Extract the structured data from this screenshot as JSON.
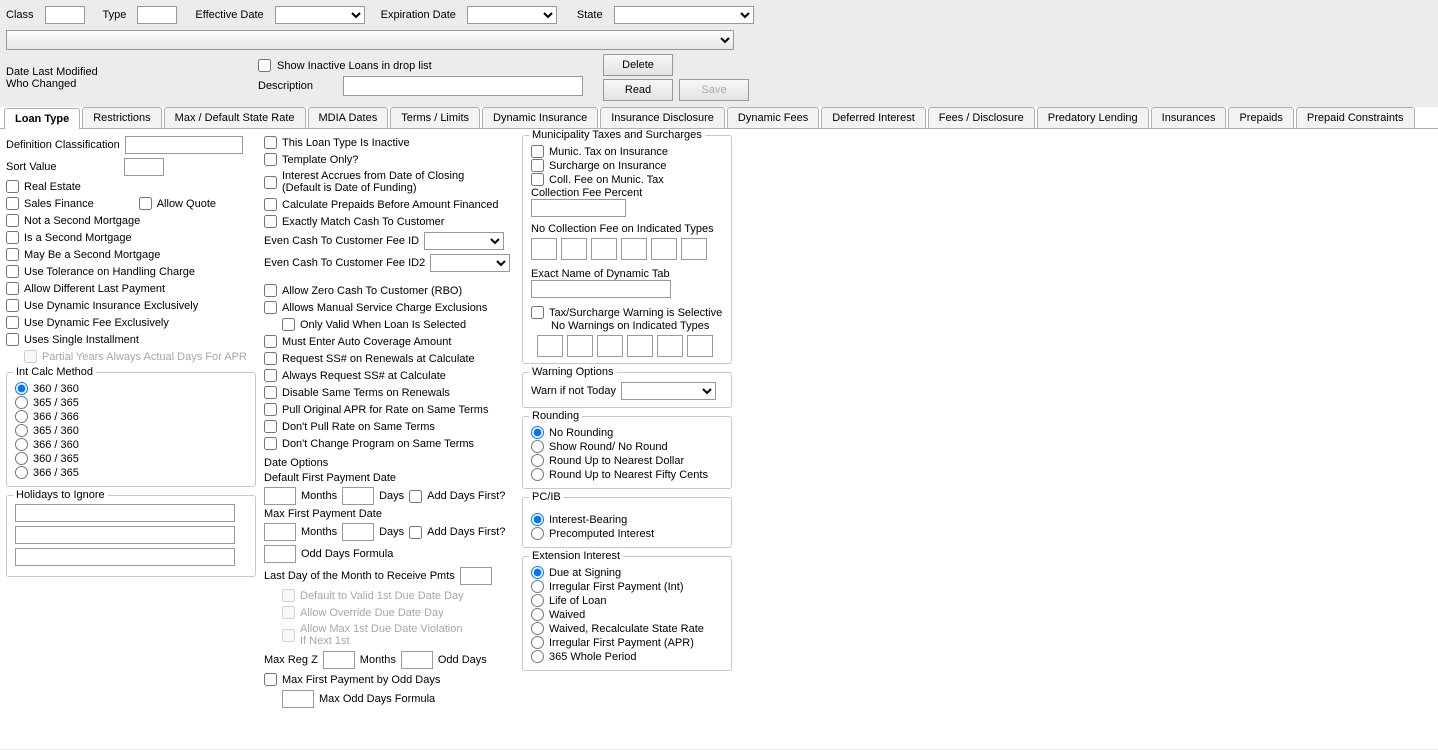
{
  "top": {
    "class_label": "Class",
    "type_label": "Type",
    "eff_date_label": "Effective Date",
    "exp_date_label": "Expiration Date",
    "state_label": "State"
  },
  "meta": {
    "date_last_modified": "Date Last Modified",
    "who_changed": "Who Changed",
    "show_inactive": "Show Inactive Loans in drop list",
    "description_label": "Description",
    "delete": "Delete",
    "read": "Read",
    "save": "Save"
  },
  "tabs": [
    "Loan Type",
    "Restrictions",
    "Max / Default State Rate",
    "MDIA Dates",
    "Terms / Limits",
    "Dynamic Insurance",
    "Insurance Disclosure",
    "Dynamic Fees",
    "Deferred Interest",
    "Fees / Disclosure",
    "Predatory Lending",
    "Insurances",
    "Prepaids",
    "Prepaid Constraints"
  ],
  "colA": {
    "def_class": "Definition Classification",
    "sort_value": "Sort Value",
    "real_estate": "Real Estate",
    "sales_finance": "Sales Finance",
    "allow_quote": "Allow Quote",
    "not_second": "Not a Second Mortgage",
    "is_second": "Is a Second Mortgage",
    "may_be_second": "May Be a Second Mortgage",
    "use_tolerance": "Use Tolerance on Handling Charge",
    "allow_diff_last": "Allow Different Last Payment",
    "use_dyn_ins": "Use Dynamic Insurance Exclusively",
    "use_dyn_fee": "Use Dynamic Fee Exclusively",
    "uses_single": "Uses Single Installment",
    "partial_years": "Partial Years Always Actual Days For APR",
    "int_calc_title": "Int Calc Method",
    "int_calc": [
      "360 / 360",
      "365 / 365",
      "366 / 366",
      "365 / 360",
      "366 / 360",
      "360 / 365",
      "366 / 365"
    ],
    "holidays_title": "Holidays to Ignore"
  },
  "colB": {
    "inactive": "This Loan Type Is Inactive",
    "template_only": "Template Only?",
    "interest_accrues": "Interest Accrues from Date of Closing (Default is Date of Funding)",
    "calc_prepaids": "Calculate Prepaids Before Amount Financed",
    "exact_match": "Exactly Match Cash To Customer",
    "even_cash_id": "Even Cash To Customer Fee ID",
    "even_cash_id2": "Even Cash To Customer Fee ID2",
    "allow_zero": "Allow Zero Cash To Customer (RBO)",
    "allows_manual": "Allows Manual Service Charge Exclusions",
    "only_valid": "Only Valid When Loan Is Selected",
    "must_enter": "Must Enter Auto Coverage Amount",
    "request_ss_renew": "Request SS# on Renewals at Calculate",
    "always_request_ss": "Always Request SS# at Calculate",
    "disable_same": "Disable Same Terms on Renewals",
    "pull_original": "Pull Original APR for Rate on Same Terms",
    "dont_pull": "Don't Pull Rate on Same Terms",
    "dont_change": "Don't Change Program on Same Terms",
    "date_options": "Date Options",
    "def_first": "Default First Payment Date",
    "months": "Months",
    "days": "Days",
    "add_days": "Add Days First?",
    "max_first": "Max First Payment Date",
    "odd_days_formula": "Odd Days Formula",
    "last_day": "Last Day of the Month to Receive Pmts",
    "default_valid": "Default to Valid 1st Due Date Day",
    "allow_override": "Allow Override Due Date Day",
    "allow_max_1st": "Allow Max 1st Due Date Violation If Next 1st",
    "max_reg_z": "Max Reg Z",
    "odd_days": "Odd Days",
    "max_first_by_odd": "Max First Payment by Odd Days",
    "max_odd_formula": "Max Odd Days Formula"
  },
  "colC": {
    "muni_title": "Municipality Taxes and Surcharges",
    "muni_tax": "Munic. Tax on Insurance",
    "surcharge": "Surcharge on Insurance",
    "coll_fee": "Coll. Fee on Munic. Tax",
    "coll_fee_pct": "Collection Fee Percent",
    "no_coll_fee": "No Collection Fee on Indicated Types",
    "exact_name": "Exact Name of Dynamic Tab",
    "tax_warn": "Tax/Surcharge Warning is Selective",
    "no_warnings": "No Warnings on Indicated Types",
    "warn_opts_title": "Warning Options",
    "warn_if_not": "Warn if not Today",
    "rounding_title": "Rounding",
    "rounding": [
      "No Rounding",
      "Show Round/ No Round",
      "Round Up to Nearest Dollar",
      "Round Up to Nearest Fifty Cents"
    ],
    "pcib_title": "PC/IB",
    "pcib": [
      "Interest-Bearing",
      "Precomputed Interest"
    ],
    "ext_title": "Extension Interest",
    "ext": [
      "Due at Signing",
      "Irregular First Payment (Int)",
      "Life of Loan",
      "Waived",
      "Waived, Recalculate State Rate",
      "Irregular First Payment (APR)",
      "365 Whole Period"
    ]
  }
}
